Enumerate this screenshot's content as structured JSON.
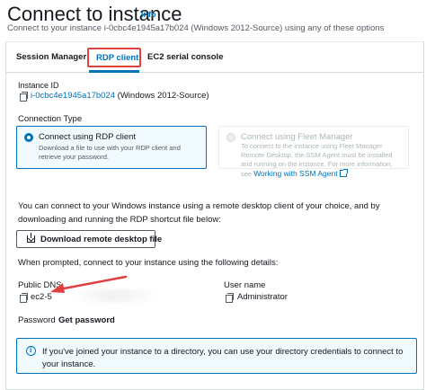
{
  "header": {
    "title": "Connect to instance",
    "info_label": "Info",
    "subtitle": "Connect to your instance i-0cbc4e1945a17b024 (Windows 2012-Source) using any of these options"
  },
  "tabs": [
    {
      "label": "Session Manager",
      "selected": false
    },
    {
      "label": "RDP client",
      "selected": true
    },
    {
      "label": "EC2 serial console",
      "selected": false
    }
  ],
  "instance": {
    "label": "Instance ID",
    "id": "i-0cbc4e1945a17b024",
    "name": "(Windows 2012-Source)"
  },
  "connection_type": {
    "label": "Connection Type",
    "options": [
      {
        "title": "Connect using RDP client",
        "description": "Download a file to use with your RDP client and retrieve your password.",
        "selected": true,
        "enabled": true
      },
      {
        "title": "Connect using Fleet Manager",
        "description": "To connect to the instance using Fleet Manager Remote Desktop, the SSM Agent must be installed and running on the instance. For more information, see",
        "link_text": "Working with SSM Agent",
        "selected": false,
        "enabled": false
      }
    ]
  },
  "rdp": {
    "description": "You can connect to your Windows instance using a remote desktop client of your choice, and by downloading and running the RDP shortcut file below:",
    "download_button": "Download remote desktop file",
    "prompt": "When prompted, connect to your instance using the following details:"
  },
  "details": {
    "public_dns_label": "Public DNS",
    "public_dns_value": "ec2-5",
    "user_name_label": "User name",
    "user_name_value": "Administrator",
    "password_label": "Password",
    "get_password": "Get password"
  },
  "alert": {
    "text": "If you've joined your instance to a directory, you can use your directory credentials to connect to your instance."
  },
  "colors": {
    "accent": "#0073bb",
    "highlight_box": "#e0413e",
    "annotation_arrow": "#e0413e",
    "info_bg": "#f1faff"
  },
  "icons": [
    "copy-icon",
    "download-icon",
    "external-link-icon",
    "info-circle-icon",
    "red-arrow-annotation"
  ]
}
